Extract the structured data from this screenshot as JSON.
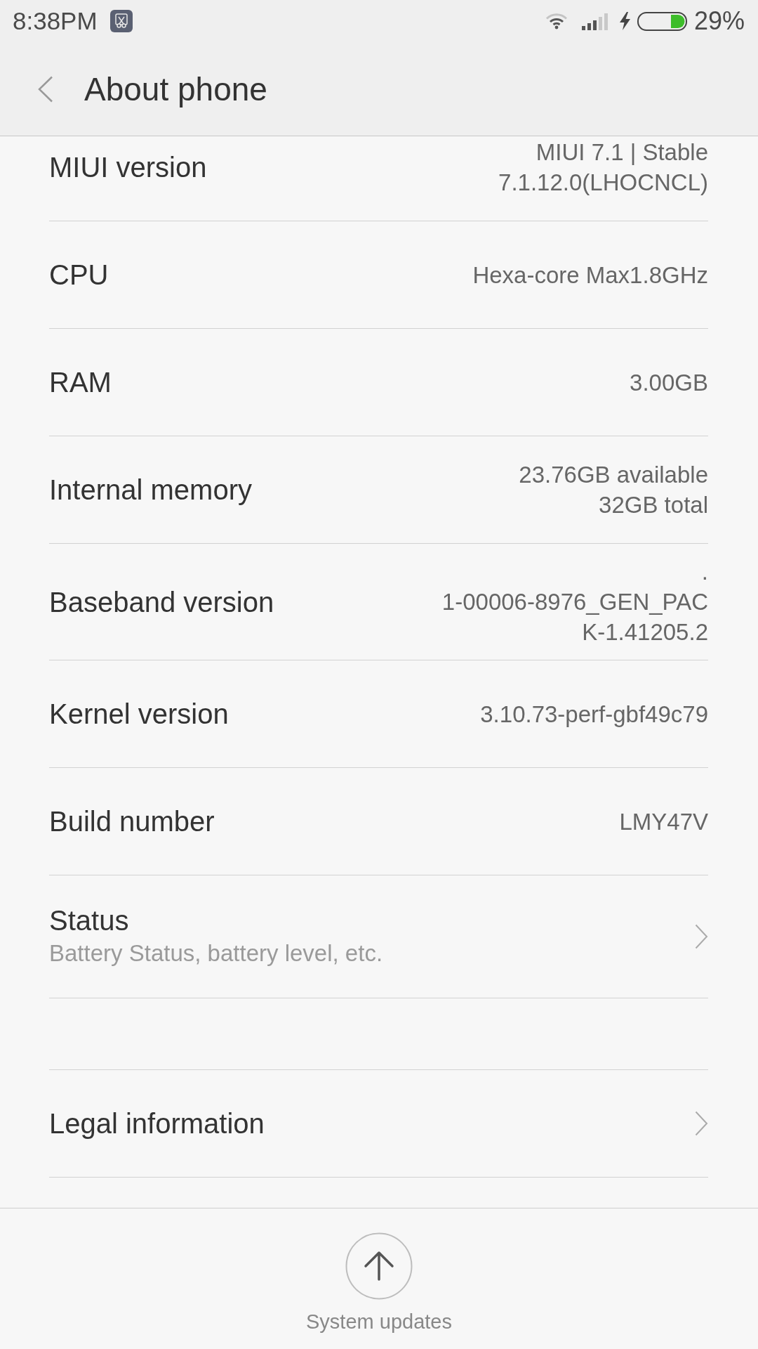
{
  "status_bar": {
    "time": "8:38PM",
    "charging": true,
    "battery_percent": "29%"
  },
  "header": {
    "title": "About phone"
  },
  "sections": [
    {
      "items": [
        {
          "kind": "info",
          "label": "MIUI version",
          "value_lines": [
            "MIUI 7.1 | Stable",
            "7.1.12.0(LHOCNCL)"
          ]
        },
        {
          "kind": "info",
          "label": "CPU",
          "value_lines": [
            "Hexa-core Max1.8GHz"
          ]
        },
        {
          "kind": "info",
          "label": "RAM",
          "value_lines": [
            "3.00GB"
          ]
        },
        {
          "kind": "info",
          "label": "Internal memory",
          "value_lines": [
            "23.76GB available",
            "32GB total"
          ]
        },
        {
          "kind": "info",
          "label": "Baseband version",
          "value_lines": [
            ".",
            "1-00006-8976_GEN_PAC",
            "K-1.41205.2"
          ]
        },
        {
          "kind": "info",
          "label": "Kernel version",
          "value_lines": [
            "3.10.73-perf-gbf49c79"
          ]
        },
        {
          "kind": "info",
          "label": "Build number",
          "value_lines": [
            "LMY47V"
          ]
        },
        {
          "kind": "link",
          "label": "Status",
          "subtitle": "Battery Status, battery level, etc."
        }
      ]
    },
    {
      "items": [
        {
          "kind": "link",
          "label": "Legal information"
        }
      ]
    }
  ],
  "bottom_bar": {
    "button": "System updates"
  }
}
